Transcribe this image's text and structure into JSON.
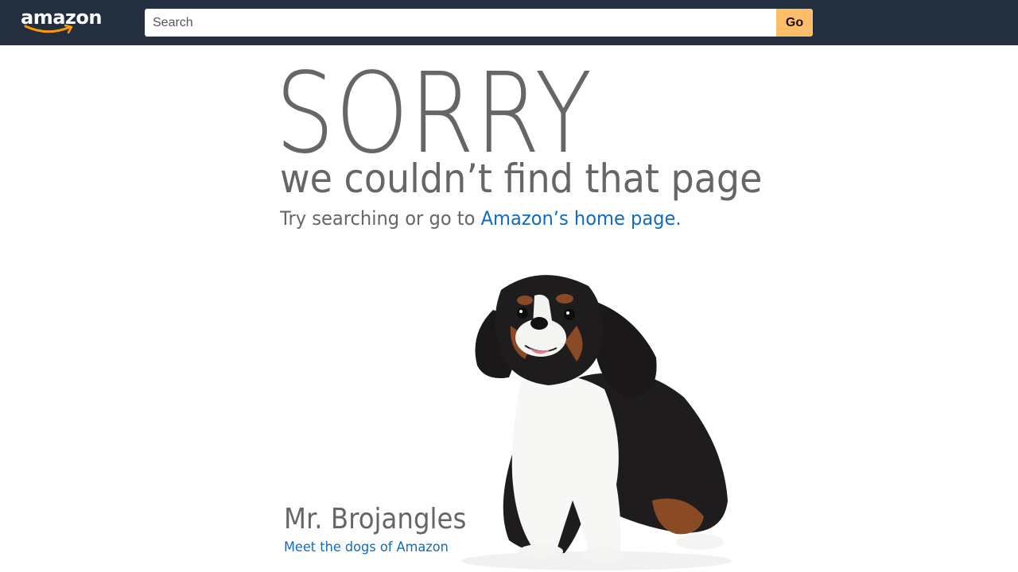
{
  "header": {
    "logo_text": "amazon",
    "search": {
      "placeholder": "Search",
      "value": ""
    },
    "go_label": "Go",
    "colors": {
      "bar": "#232f3e",
      "go_button": "#febd69",
      "logo_smile": "#ff9900"
    }
  },
  "error": {
    "heading": "SORRY",
    "subheading": "we couldn’t find that page",
    "prompt_prefix": "Try searching or go to ",
    "home_link": "Amazon’s home page",
    "prompt_suffix": "."
  },
  "dog": {
    "name": "Mr. Brojangles",
    "link": "Meet the dogs of Amazon"
  },
  "colors": {
    "text": "#666666",
    "link": "#0f6cbf"
  }
}
